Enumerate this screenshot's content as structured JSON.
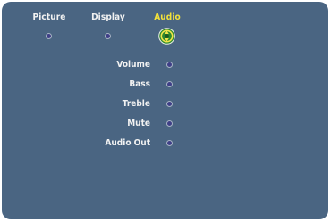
{
  "tabs": [
    {
      "label": "Picture",
      "active": false
    },
    {
      "label": "Display",
      "active": false
    },
    {
      "label": "Audio",
      "active": true
    }
  ],
  "audio_menu": {
    "items": [
      {
        "label": "Volume"
      },
      {
        "label": "Bass"
      },
      {
        "label": "Treble"
      },
      {
        "label": "Mute"
      },
      {
        "label": "Audio Out"
      }
    ]
  },
  "colors": {
    "background": "#4a6582",
    "text": "#f2f2f2",
    "active_text": "#f4e23a",
    "selection_ring": "#2f8a2f",
    "dot": "#3f3f87"
  }
}
